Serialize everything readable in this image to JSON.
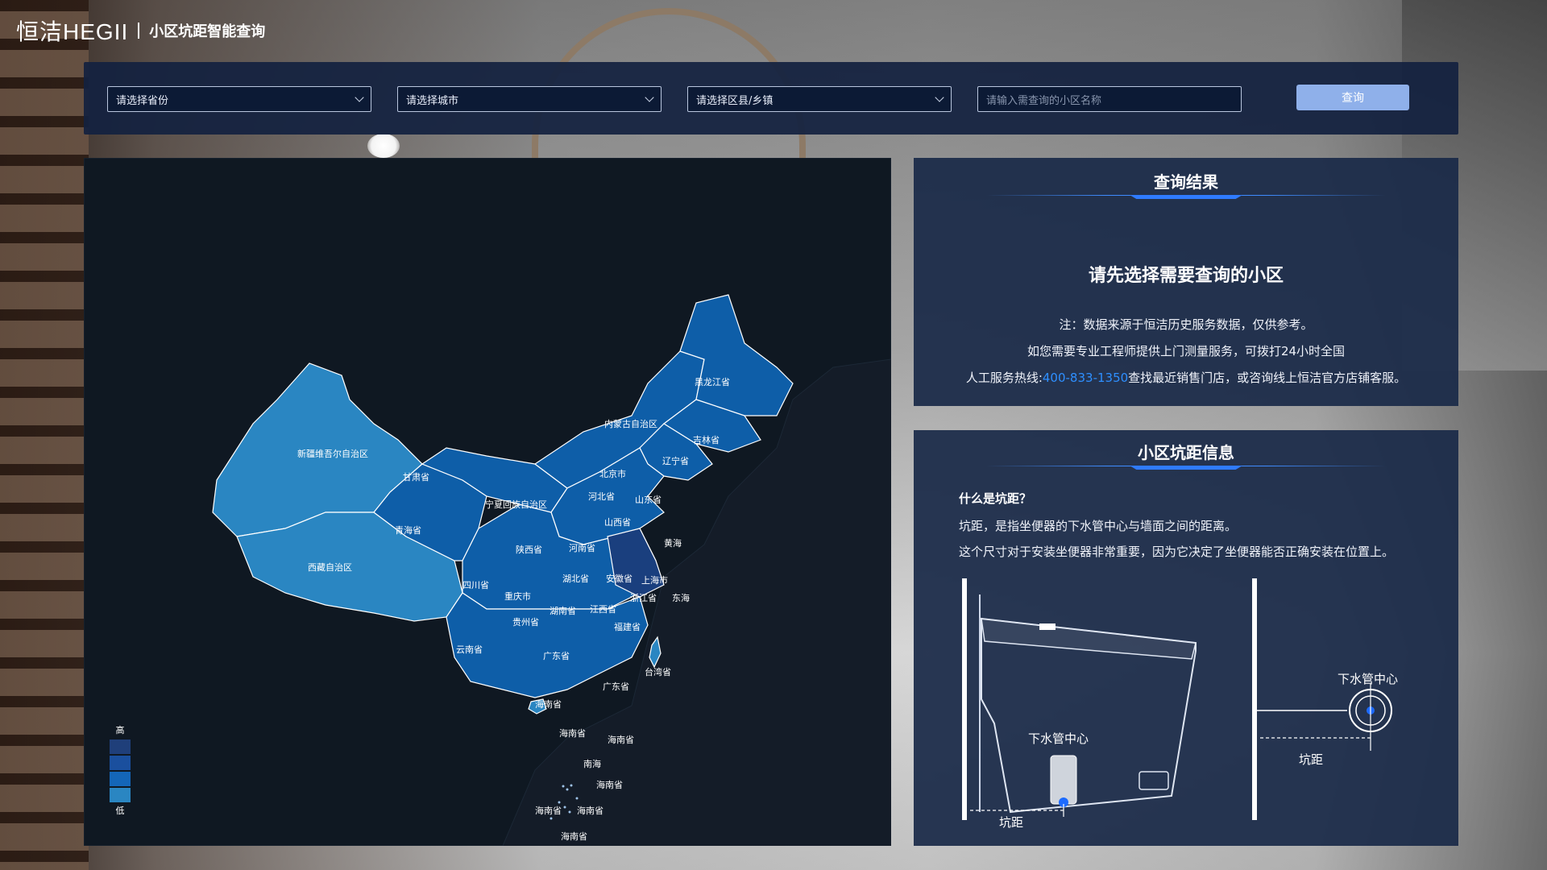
{
  "header": {
    "brand_logo": "恒洁HEGII",
    "page_title": "小区坑距智能查询"
  },
  "query": {
    "province_placeholder": "请选择省份",
    "city_placeholder": "请选择城市",
    "district_placeholder": "请选择区县/乡镇",
    "community_placeholder": "请输入需查询的小区名称",
    "search_label": "查询"
  },
  "map": {
    "labels": {
      "xinjiang": "新疆维吾尔自治区",
      "xizang": "西藏自治区",
      "qinghai": "青海省",
      "gansu": "甘肃省",
      "neimenggu": "内蒙古自治区",
      "heilongjiang": "黑龙江省",
      "jilin": "吉林省",
      "liaoning": "辽宁省",
      "beijing": "北京市",
      "hebei": "河北省",
      "shandong": "山东省",
      "shanxi": "山西省",
      "ningxia": "宁夏回族自治区",
      "shaanxi": "陕西省",
      "henan": "河南省",
      "sichuan": "四川省",
      "chongqing": "重庆市",
      "hubei": "湖北省",
      "anhui": "安徽省",
      "shanghai": "上海市",
      "zhejiang": "浙江省",
      "jiangxi": "江西省",
      "hunan": "湖南省",
      "guizhou": "贵州省",
      "yunnan": "云南省",
      "fujian": "福建省",
      "taiwan": "台湾省",
      "guangdong": "广东省",
      "guangxi": "广东省",
      "hainan": "海南省",
      "huanghai": "黄海",
      "donghai": "东海",
      "nanhai": "南海",
      "island_1": "海南省",
      "island_2": "海南省",
      "island_3": "海南省",
      "island_4": "海南省",
      "island_5": "海南省",
      "island_6": "海南省"
    },
    "legend": {
      "high": "高",
      "low": "低",
      "colors": [
        "#1f3f7a",
        "#1a4f9e",
        "#1466b8",
        "#2a86c2"
      ]
    },
    "colors": {
      "background": "#141c28",
      "land_dark": "#0e1620",
      "region_primary": "#0e5ea8",
      "region_light": "#2a86c2",
      "region_deep": "#1a3f7e",
      "border": "#ffffff"
    }
  },
  "result": {
    "title": "查询结果",
    "heading": "请先选择需要查询的小区",
    "note_line1": "注：数据来源于恒洁历史服务数据，仅供参考。",
    "note_line2": "如您需要专业工程师提供上门测量服务，可拨打24小时全国",
    "note_line3_prefix": "人工服务热线:",
    "hotline": "400-833-1350",
    "note_line3_suffix": "查找最近销售门店，或咨询线上恒洁官方店铺客服。"
  },
  "info": {
    "title": "小区坑距信息",
    "question": "什么是坑距？",
    "answer1": "坑距，是指坐便器的下水管中心与墙面之间的距离。",
    "answer2": "这个尺寸对于安装坐便器非常重要，因为它决定了坐便器能否正确安装在位置上。",
    "diagram_left_drain": "下水管中心",
    "diagram_left_distance": "坑距",
    "diagram_right_drain": "下水管中心",
    "diagram_right_distance": "坑距"
  }
}
